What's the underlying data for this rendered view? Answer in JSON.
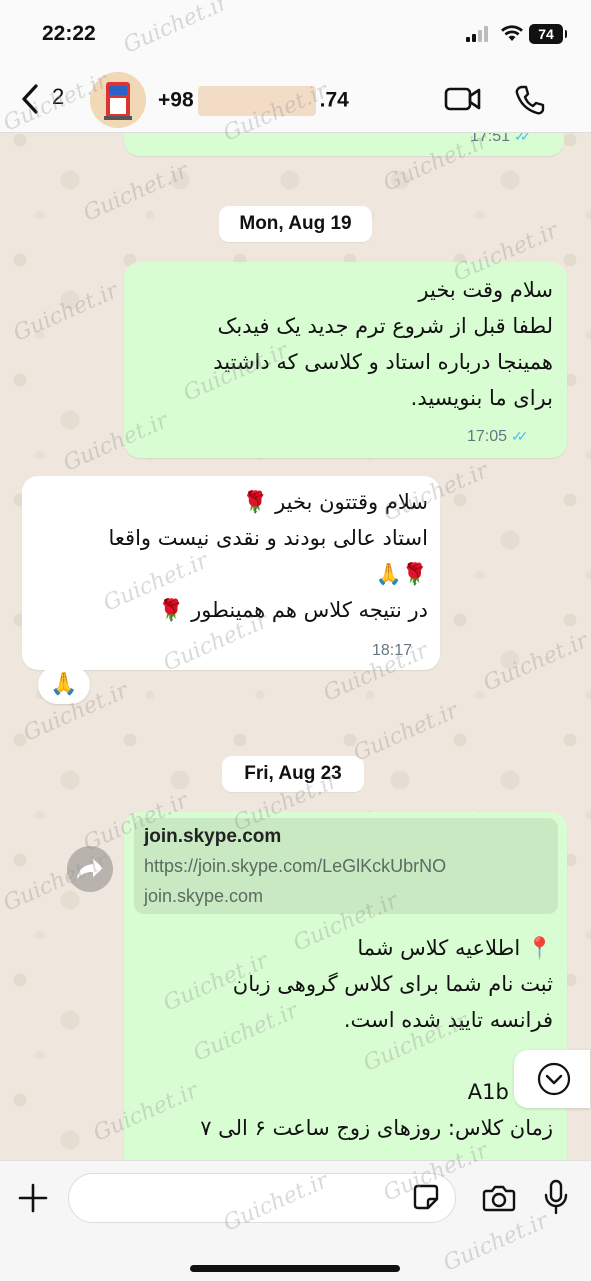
{
  "status_bar": {
    "time": "22:22",
    "battery": "74"
  },
  "header": {
    "back_count": "2",
    "phone_prefix": "+98",
    "phone_suffix": ".74"
  },
  "top_partial": {
    "time": "17:51"
  },
  "dates": {
    "first": "Mon, Aug 19",
    "second": "Fri, Aug 23"
  },
  "messages": [
    {
      "direction": "out",
      "text": "سلام وقت بخیر\nلطفا قبل از شروع ترم جدید یک فیدبک\nهمینجا درباره استاد و کلاسی که داشتید\nبرای ما بنویسید.",
      "time": "17:05"
    },
    {
      "direction": "in",
      "text": "سلام وقتتون بخیر 🌹\nاستاد عالی بودند و نقدی نیست واقعا\n🌹🙏\nدر نتیجه کلاس هم همینطور 🌹",
      "time": "18:17",
      "reaction": "🙏"
    },
    {
      "direction": "out",
      "link_title": "join.skype.com",
      "link_url": "https://join.skype.com/LeGlKckUbrNO",
      "link_domain": "join.skype.com",
      "text": "📍 اطلاعیه کلاس شما\nثبت نام شما برای کلاس گروهی زبان\nفرانسه تایید شده است.\n\nترم: A1b\nزمان کلاس: روزهای زوج ساعت ۶ الی ۷"
    }
  ],
  "composer": {
    "placeholder": ""
  },
  "watermark": "Guichet.ir",
  "icons": {
    "back": "chevron-left-icon",
    "video": "video-camera-icon",
    "call": "phone-icon",
    "forward": "forward-arrow-icon",
    "scroll": "chevron-down-icon",
    "plus": "plus-icon",
    "sticker": "sticker-icon",
    "camera": "camera-icon",
    "mic": "microphone-icon"
  },
  "colors": {
    "outgoing": "#d9fdd3",
    "incoming": "#ffffff",
    "read_ticks": "#53bdeb",
    "wallpaper": "#efe7dd"
  }
}
